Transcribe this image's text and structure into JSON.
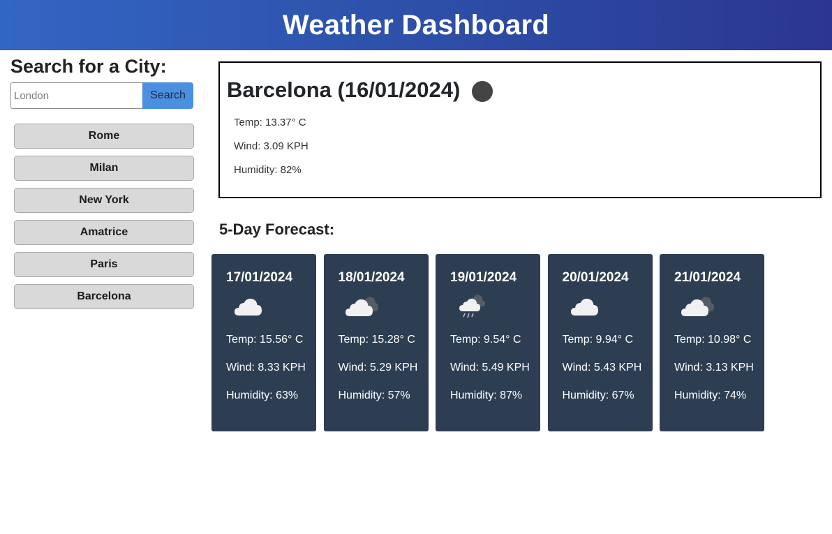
{
  "header": {
    "title": "Weather Dashboard"
  },
  "sidebar": {
    "heading": "Search for a City:",
    "search": {
      "placeholder": "London",
      "value": "",
      "button_label": "Search"
    },
    "history": [
      "Rome",
      "Milan",
      "New York",
      "Amatrice",
      "Paris",
      "Barcelona"
    ]
  },
  "current": {
    "title": "Barcelona (16/01/2024)",
    "icon": "weather-icon-dark-circle",
    "temp": "Temp: 13.37° C",
    "wind": "Wind: 3.09 KPH",
    "humidity": "Humidity: 82%"
  },
  "forecast": {
    "heading": "5-Day Forecast:",
    "days": [
      {
        "date": "17/01/2024",
        "icon": "cloud-icon",
        "temp": "Temp: 15.56° C",
        "wind": "Wind: 8.33 KPH",
        "humidity": "Humidity: 63%"
      },
      {
        "date": "18/01/2024",
        "icon": "broken-clouds-icon",
        "temp": "Temp: 15.28° C",
        "wind": "Wind: 5.29 KPH",
        "humidity": "Humidity: 57%"
      },
      {
        "date": "19/01/2024",
        "icon": "rain-cloud-icon",
        "temp": "Temp: 9.54° C",
        "wind": "Wind: 5.49 KPH",
        "humidity": "Humidity: 87%"
      },
      {
        "date": "20/01/2024",
        "icon": "cloud-icon",
        "temp": "Temp: 9.94° C",
        "wind": "Wind: 5.43 KPH",
        "humidity": "Humidity: 67%"
      },
      {
        "date": "21/01/2024",
        "icon": "broken-clouds-icon",
        "temp": "Temp: 10.98° C",
        "wind": "Wind: 3.13 KPH",
        "humidity": "Humidity: 74%"
      }
    ]
  },
  "colors": {
    "header_start": "#3266c4",
    "header_end": "#2b3690",
    "card_bg": "#2d3e52",
    "search_button": "#4a8fe0"
  }
}
